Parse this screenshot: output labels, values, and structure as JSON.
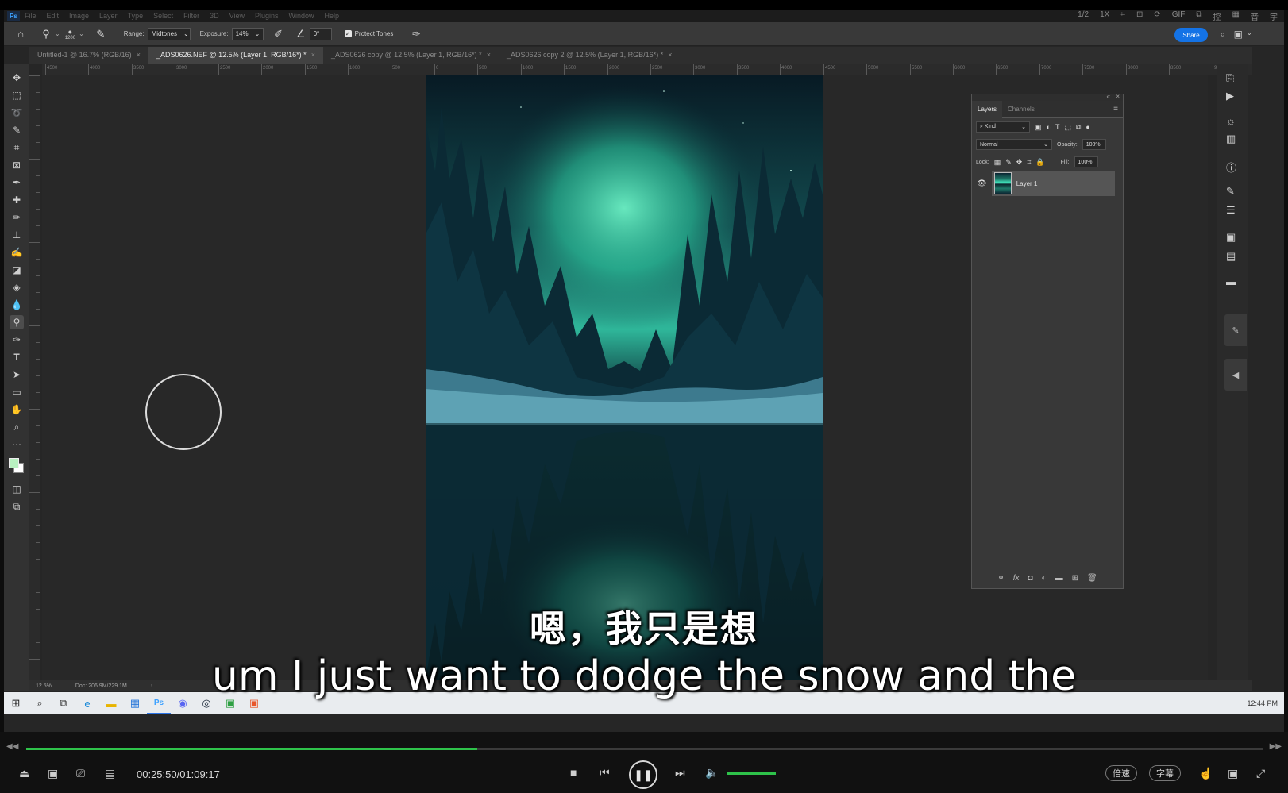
{
  "photoshop": {
    "logo": "Ps",
    "menu": [
      "File",
      "Edit",
      "Image",
      "Layer",
      "Type",
      "Select",
      "Filter",
      "3D",
      "View",
      "Plugins",
      "Window",
      "Help"
    ],
    "player_overlay_icons": [
      "1/2",
      "1X",
      "crop-icon",
      "fit-icon",
      "rotate-icon",
      "GIF",
      "pip-icon",
      "控",
      "grid-icon",
      "音",
      "字"
    ],
    "options": {
      "brush_size": "1200",
      "range_label": "Range:",
      "range_value": "Midtones",
      "exposure_label": "Exposure:",
      "exposure_value": "14%",
      "angle_value": "0°",
      "protect_tones_label": "Protect Tones",
      "share_label": "Share"
    },
    "tabs": [
      {
        "label": "Untitled-1 @ 16.7% (RGB/16)",
        "active": false
      },
      {
        "label": "_ADS0626.NEF @ 12.5% (Layer 1, RGB/16*) *",
        "active": true
      },
      {
        "label": "_ADS0626 copy @ 12.5% (Layer 1, RGB/16*) *",
        "active": false
      },
      {
        "label": "_ADS0626 copy 2 @ 12.5% (Layer 1, RGB/16*) *",
        "active": false
      }
    ],
    "ruler_labels": [
      "4500",
      "4000",
      "3500",
      "3000",
      "2500",
      "2000",
      "1500",
      "1000",
      "500",
      "0",
      "500",
      "1000",
      "1500",
      "2000",
      "2500",
      "3000",
      "3500",
      "4000",
      "4500",
      "5000",
      "5500",
      "6000",
      "6500",
      "7000",
      "7500",
      "8000",
      "8500",
      "9000"
    ],
    "layers_panel": {
      "tab_layers": "Layers",
      "tab_channels": "Channels",
      "kind_label": "Kind",
      "blend_mode": "Normal",
      "opacity_label": "Opacity:",
      "opacity_value": "100%",
      "lock_label": "Lock:",
      "fill_label": "Fill:",
      "fill_value": "100%",
      "layer_name": "Layer 1"
    },
    "status": {
      "zoom": "12.5%",
      "doc": "Doc: 206.9M/229.1M"
    },
    "taskbar_clock": "12:44 PM"
  },
  "subtitles": {
    "chinese": "嗯，我只是想",
    "english": "um I just want to dodge the snow and the"
  },
  "player": {
    "progress": 0.365,
    "time": "00:25:50/01:09:17",
    "volume": 1.0,
    "speed_label": "倍速",
    "subtitle_label": "字幕",
    "accent_color": "#2ec24a"
  }
}
